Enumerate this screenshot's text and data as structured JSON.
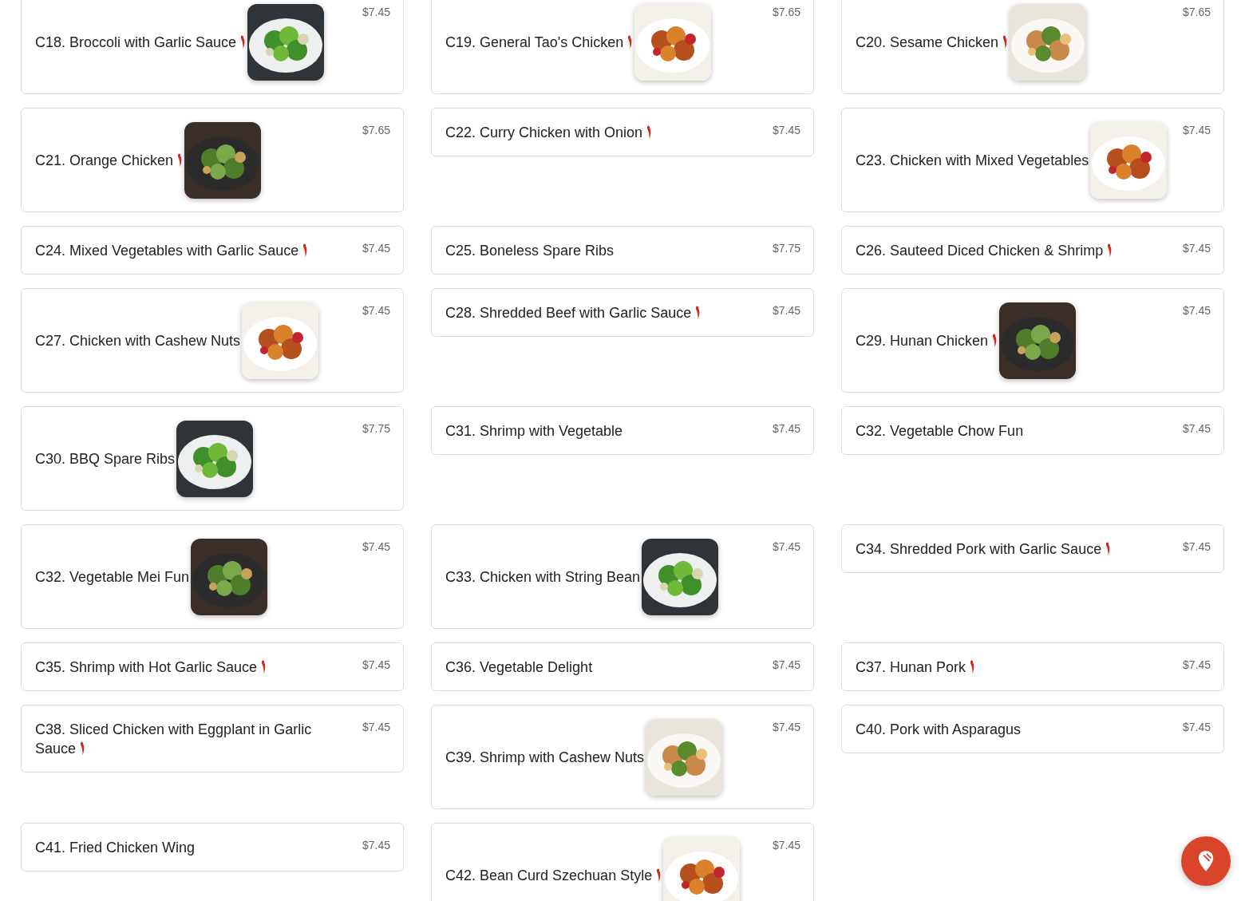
{
  "menu_items": [
    {
      "name": "C18. Broccoli with Garlic Sauce",
      "spicy": true,
      "price": "$7.45",
      "photo": true
    },
    {
      "name": "C19. General Tao's Chicken",
      "spicy": true,
      "price": "$7.65",
      "photo": true
    },
    {
      "name": "C20. Sesame Chicken",
      "spicy": true,
      "price": "$7.65",
      "photo": true
    },
    {
      "name": "C21. Orange Chicken",
      "spicy": true,
      "price": "$7.65",
      "photo": true
    },
    {
      "name": "C22. Curry Chicken with Onion",
      "spicy": true,
      "price": "$7.45",
      "photo": false
    },
    {
      "name": "C23. Chicken with Mixed Vegetables",
      "spicy": false,
      "price": "$7.45",
      "photo": true
    },
    {
      "name": "C24. Mixed Vegetables with Garlic Sauce",
      "spicy": true,
      "price": "$7.45",
      "photo": false
    },
    {
      "name": "C25. Boneless Spare Ribs",
      "spicy": false,
      "price": "$7.75",
      "photo": false
    },
    {
      "name": "C26. Sauteed Diced Chicken & Shrimp",
      "spicy": true,
      "price": "$7.45",
      "photo": false
    },
    {
      "name": "C27. Chicken with Cashew Nuts",
      "spicy": false,
      "price": "$7.45",
      "photo": true
    },
    {
      "name": "C28. Shredded Beef with Garlic Sauce",
      "spicy": true,
      "price": "$7.45",
      "photo": false
    },
    {
      "name": "C29. Hunan Chicken",
      "spicy": true,
      "price": "$7.45",
      "photo": true
    },
    {
      "name": "C30. BBQ Spare Ribs",
      "spicy": false,
      "price": "$7.75",
      "photo": true
    },
    {
      "name": "C31. Shrimp with Vegetable",
      "spicy": false,
      "price": "$7.45",
      "photo": false
    },
    {
      "name": "C32. Vegetable Chow Fun",
      "spicy": false,
      "price": "$7.45",
      "photo": false
    },
    {
      "name": "C32. Vegetable Mei Fun",
      "spicy": false,
      "price": "$7.45",
      "photo": true
    },
    {
      "name": "C33. Chicken with String Bean",
      "spicy": false,
      "price": "$7.45",
      "photo": true
    },
    {
      "name": "C34. Shredded Pork with Garlic Sauce",
      "spicy": true,
      "price": "$7.45",
      "photo": false
    },
    {
      "name": "C35. Shrimp with Hot Garlic Sauce",
      "spicy": true,
      "price": "$7.45",
      "photo": false
    },
    {
      "name": "C36. Vegetable Delight",
      "spicy": false,
      "price": "$7.45",
      "photo": false
    },
    {
      "name": "C37. Hunan Pork",
      "spicy": true,
      "price": "$7.45",
      "photo": false
    },
    {
      "name": "C38. Sliced Chicken with Eggplant in Garlic Sauce",
      "spicy": true,
      "price": "$7.45",
      "photo": false
    },
    {
      "name": "C39. Shrimp with Cashew Nuts",
      "spicy": false,
      "price": "$7.45",
      "photo": true
    },
    {
      "name": "C40. Pork with Asparagus",
      "spicy": false,
      "price": "$7.45",
      "photo": false
    },
    {
      "name": "C41. Fried Chicken Wing",
      "spicy": false,
      "price": "$7.45",
      "photo": false
    },
    {
      "name": "C42. Bean Curd Szechuan Style",
      "spicy": true,
      "price": "$7.45",
      "photo": true
    }
  ]
}
